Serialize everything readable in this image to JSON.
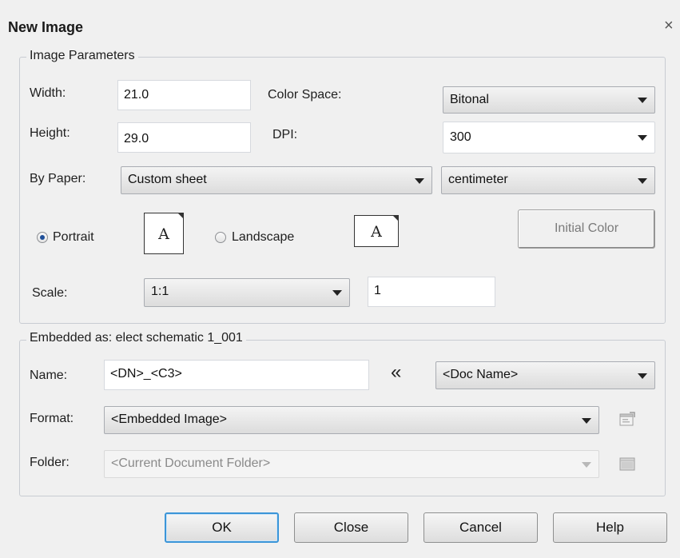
{
  "dialog": {
    "title": "New Image",
    "close_symbol": "×"
  },
  "image_parameters": {
    "legend": "Image Parameters",
    "width_label": "Width:",
    "width_value": "21.0",
    "height_label": "Height:",
    "height_value": "29.0",
    "color_space_label": "Color Space:",
    "color_space_value": "Bitonal",
    "dpi_label": "DPI:",
    "dpi_value": "300",
    "by_paper_label": "By Paper:",
    "paper_value": "Custom sheet",
    "unit_value": "centimeter",
    "portrait_label": "Portrait",
    "portrait_checked": true,
    "landscape_label": "Landscape",
    "landscape_checked": false,
    "page_glyph": "A",
    "initial_color_label": "Initial Color",
    "scale_label": "Scale:",
    "scale_value": "1:1",
    "scale_number": "1"
  },
  "embedded": {
    "legend": "Embedded as: elect schematic 1_001",
    "name_label": "Name:",
    "name_value": "<DN>_<C3>",
    "insert_symbol": "«",
    "doc_name_value": "<Doc Name>",
    "format_label": "Format:",
    "format_value": "<Embedded Image>",
    "folder_label": "Folder:",
    "folder_value": "<Current Document Folder>"
  },
  "buttons": {
    "ok": "OK",
    "close": "Close",
    "cancel": "Cancel",
    "help": "Help"
  },
  "icons": {
    "format_settings": "settings-window-icon",
    "folder_browse": "folder-icon",
    "dialog_close": "close-icon"
  },
  "colors": {
    "default_button_border": "#3b95d8",
    "radio_dot": "#1f4f99",
    "background": "#f0f0f0"
  }
}
